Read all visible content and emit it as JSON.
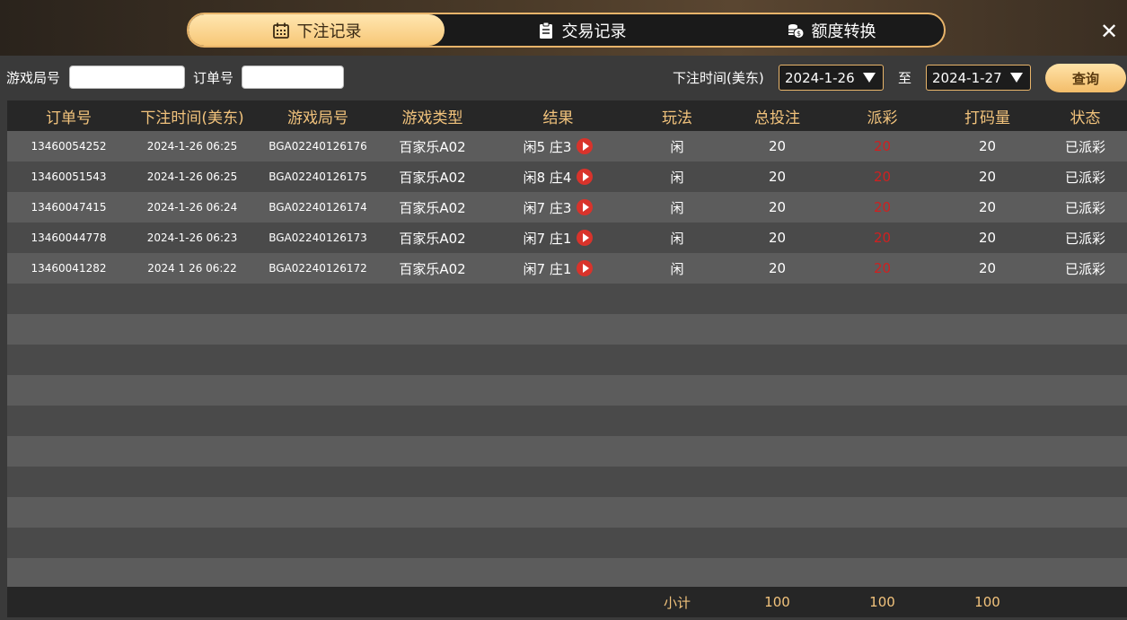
{
  "tabs": [
    {
      "label": "下注记录",
      "icon": "calendar-icon",
      "active": true
    },
    {
      "label": "交易记录",
      "icon": "clipboard-icon",
      "active": false
    },
    {
      "label": "额度转换",
      "icon": "coins-icon",
      "active": false
    }
  ],
  "filters": {
    "game_no_label": "游戏局号",
    "game_no_value": "",
    "order_no_label": "订单号",
    "order_no_value": "",
    "time_label": "下注时间(美东)",
    "date_from": "2024-1-26",
    "to_label": "至",
    "date_to": "2024-1-27",
    "query_label": "查询"
  },
  "table": {
    "headers": [
      "订单号",
      "下注时间(美东)",
      "游戏局号",
      "游戏类型",
      "结果",
      "玩法",
      "总投注",
      "派彩",
      "打码量",
      "状态"
    ],
    "rows": [
      {
        "order": "13460054252",
        "time": "2024-1-26 06:25",
        "game_no": "BGA02240126176",
        "game_type": "百家乐A02",
        "result": "闲5 庄3",
        "play": "闲",
        "bet": "20",
        "payout": "20",
        "turnover": "20",
        "status": "已派彩"
      },
      {
        "order": "13460051543",
        "time": "2024-1-26 06:25",
        "game_no": "BGA02240126175",
        "game_type": "百家乐A02",
        "result": "闲8 庄4",
        "play": "闲",
        "bet": "20",
        "payout": "20",
        "turnover": "20",
        "status": "已派彩"
      },
      {
        "order": "13460047415",
        "time": "2024-1-26 06:24",
        "game_no": "BGA02240126174",
        "game_type": "百家乐A02",
        "result": "闲7 庄3",
        "play": "闲",
        "bet": "20",
        "payout": "20",
        "turnover": "20",
        "status": "已派彩"
      },
      {
        "order": "13460044778",
        "time": "2024-1-26 06:23",
        "game_no": "BGA02240126173",
        "game_type": "百家乐A02",
        "result": "闲7 庄1",
        "play": "闲",
        "bet": "20",
        "payout": "20",
        "turnover": "20",
        "status": "已派彩"
      },
      {
        "order": "13460041282",
        "time": "2024 1 26 06:22",
        "game_no": "BGA02240126172",
        "game_type": "百家乐A02",
        "result": "闲7 庄1",
        "play": "闲",
        "bet": "20",
        "payout": "20",
        "turnover": "20",
        "status": "已派彩"
      }
    ],
    "subtotal": {
      "label": "小计",
      "bet": "100",
      "payout": "100",
      "turnover": "100"
    }
  },
  "colors": {
    "accent": "#f2c37c",
    "payout_red": "#d02020"
  }
}
